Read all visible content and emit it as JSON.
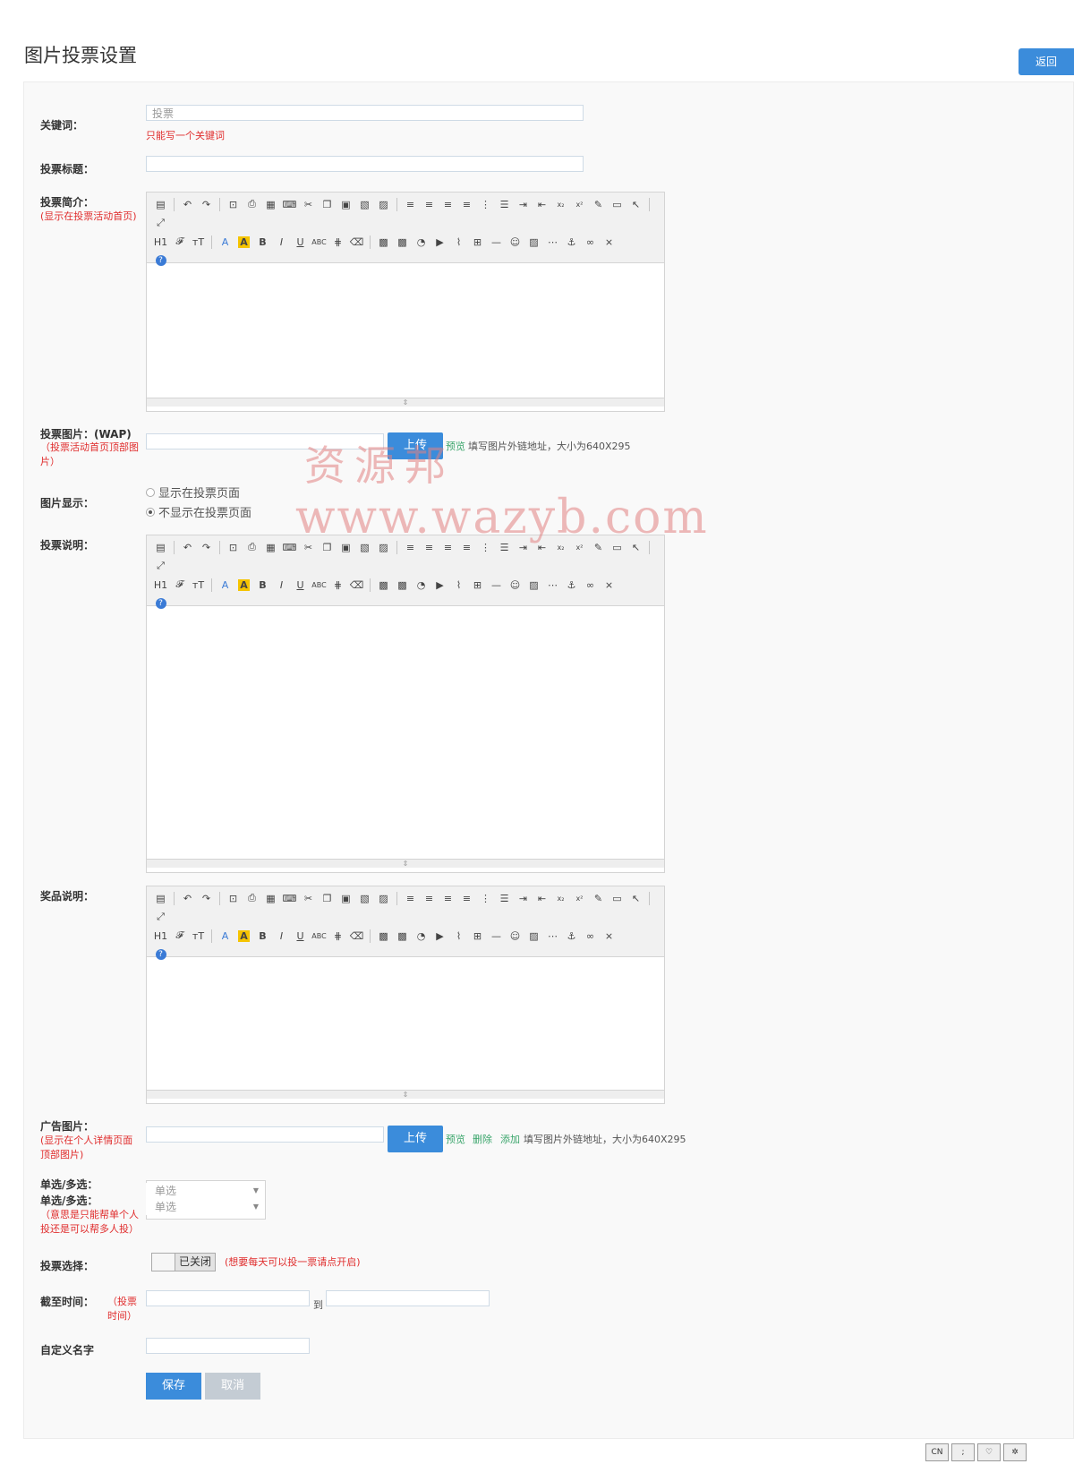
{
  "page": {
    "title": "图片投票设置",
    "back_label": "返回"
  },
  "fields": {
    "keyword": {
      "label": "关键词：",
      "value": "投票",
      "hint": "只能写一个关键词"
    },
    "vote_title": {
      "label": "投票标题：",
      "value": ""
    },
    "intro": {
      "label": "投票简介：",
      "sublabel": "(显示在投票活动首页)"
    },
    "wap_image": {
      "label": "投票图片：(WAP)",
      "sublabel": "（投票活动首页顶部图片）",
      "upload": "上传",
      "preview": "预览",
      "hint": "填写图片外链地址，大小为640X295"
    },
    "image_display": {
      "label": "图片显示：",
      "options": [
        "显示在投票页面",
        "不显示在投票页面"
      ],
      "selected_index": 1
    },
    "vote_desc": {
      "label": "投票说明："
    },
    "prize_desc": {
      "label": "奖品说明："
    },
    "ad_image": {
      "label": "广告图片：",
      "sublabel": "(显示在个人详情页面顶部图片)",
      "upload": "上传",
      "preview": "预览",
      "delete": "删除",
      "add": "添加",
      "hint": "填写图片外链地址，大小为640X295"
    },
    "single_multi": {
      "label1": "单选/多选：",
      "label2": "单选/多选：",
      "sublabel": "（意思是只能帮单个人投还是可以帮多人投）",
      "select1": "单选",
      "select2": "单选"
    },
    "vote_select": {
      "label": "投票选择：",
      "toggle": "已关闭",
      "hint": "(想要每天可以投一票请点开启)"
    },
    "deadline": {
      "label": "截至时间：",
      "sublabel": "（投票时间）",
      "to": "到"
    },
    "custom_name": {
      "label": "自定义名字"
    }
  },
  "buttons": {
    "save": "保存",
    "cancel": "取消"
  },
  "editor": {
    "resize_handle": "⇕"
  },
  "watermark": {
    "line1": "资源邦",
    "line2": "www.wazyb.com"
  },
  "bottom_tools": [
    "CN",
    ";",
    "♡",
    "✲"
  ],
  "colors": {
    "primary": "#3b8cdb",
    "hint_red": "#e02d2d",
    "link_green": "#3aa56b"
  }
}
